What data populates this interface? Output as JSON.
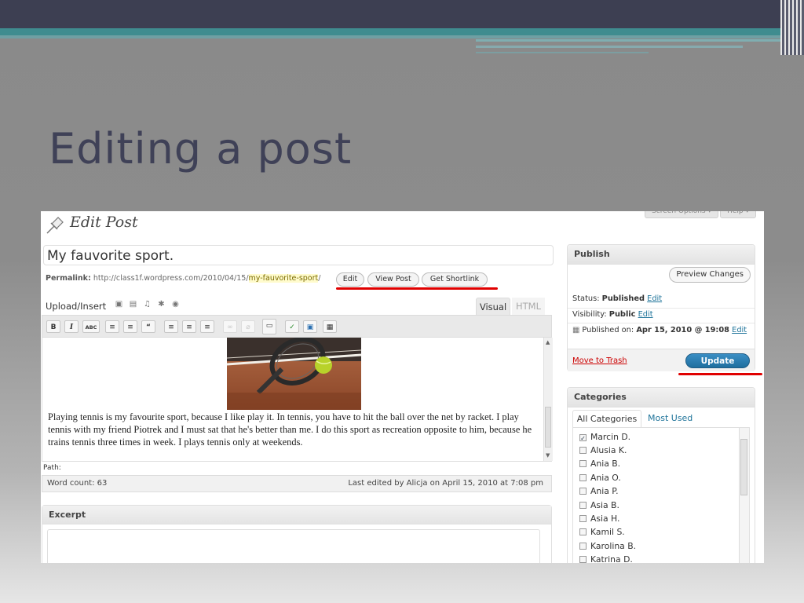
{
  "slide": {
    "title": "Editing a post"
  },
  "wp": {
    "screen_options": "Screen Options ▾",
    "help": "Help ▾",
    "page_heading": "Edit Post",
    "post_title": "My fauvorite sport.",
    "permalink_label": "Permalink:",
    "permalink_base": "http://class1f.wordpress.com/2010/04/15/",
    "permalink_slug": "my-fauvorite-sport",
    "permalink_end": "/",
    "permalink_buttons": [
      "Edit",
      "View Post",
      "Get Shortlink"
    ],
    "upload_insert": "Upload/Insert",
    "tabs": {
      "visual": "Visual",
      "html": "HTML"
    },
    "toolbar_buttons": [
      "B",
      "I",
      "ABC",
      "≡",
      "≡",
      "“",
      "≡",
      "≡",
      "≡",
      "∞",
      "⌀",
      "▭",
      "✓",
      "▣",
      "▦"
    ],
    "post_body": "Playing tennis is my favourite sport, because I like play it. In tennis, you have to hit the ball over the net by racket. I play tennis with my friend Piotrek and I must sat that he's better than me. I do this sport as recreation opposite to him, because he trains tennis three times in week. I plays tennis only at weekends.",
    "path_label": "Path:",
    "word_count": "Word count: 63",
    "last_edited": "Last edited by Alicja on April 15, 2010 at 7:08 pm",
    "excerpt_heading": "Excerpt"
  },
  "publish": {
    "heading": "Publish",
    "preview_button": "Preview Changes",
    "status_label": "Status:",
    "status_value": "Published",
    "visibility_label": "Visibility:",
    "visibility_value": "Public",
    "published_label": "Published on:",
    "published_value": "Apr 15, 2010 @ 19:08",
    "edit_link": "Edit",
    "move_to_trash": "Move to Trash",
    "update_button": "Update"
  },
  "categories": {
    "heading": "Categories",
    "tab_all": "All Categories",
    "tab_most_used": "Most Used",
    "items": [
      {
        "name": "Marcin D.",
        "checked": true
      },
      {
        "name": "Alusia K.",
        "checked": false
      },
      {
        "name": "Ania B.",
        "checked": false
      },
      {
        "name": "Ania O.",
        "checked": false
      },
      {
        "name": "Ania P.",
        "checked": false
      },
      {
        "name": "Asia B.",
        "checked": false
      },
      {
        "name": "Asia H.",
        "checked": false
      },
      {
        "name": "Kamil S.",
        "checked": false
      },
      {
        "name": "Karolina B.",
        "checked": false
      },
      {
        "name": "Katrina D.",
        "checked": false
      }
    ]
  },
  "colors": {
    "slide_title": "#3f4157",
    "update_button": "#2a7fb3",
    "highlight_underline": "#e00000",
    "link": "#21759b"
  }
}
